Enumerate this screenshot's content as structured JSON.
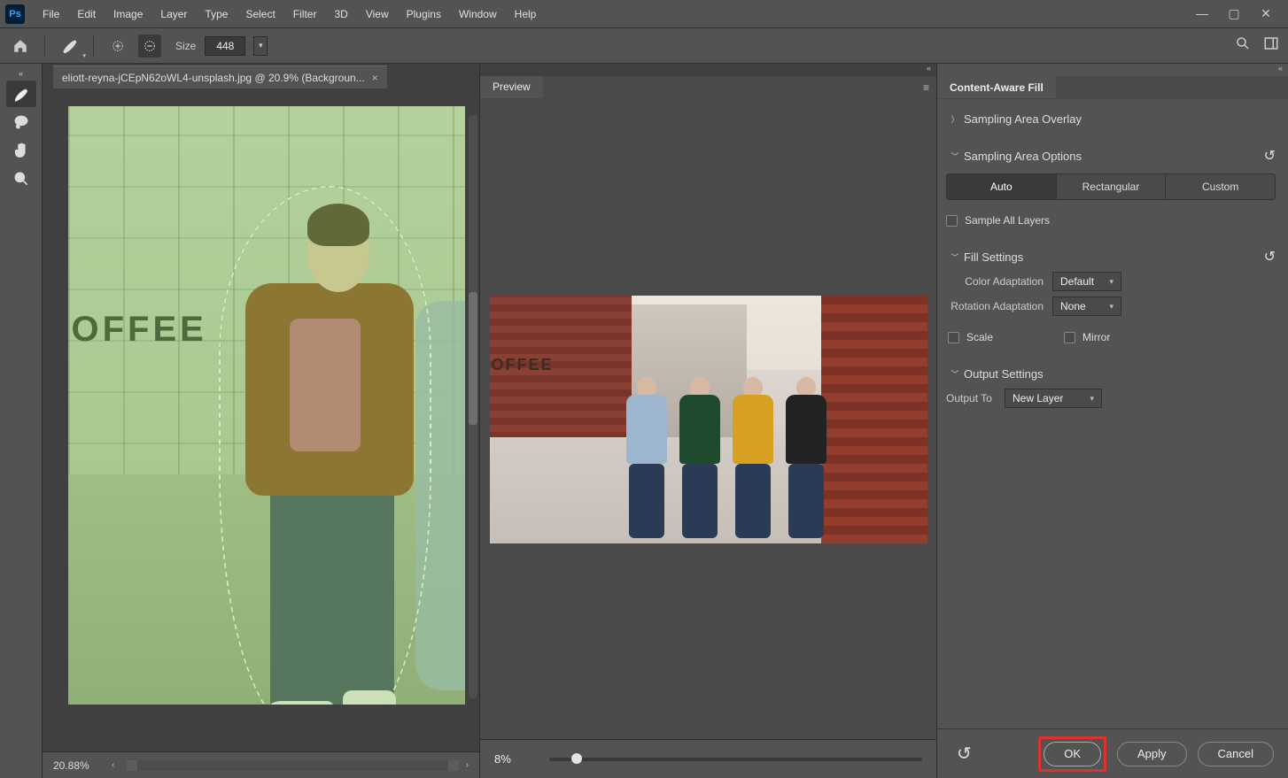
{
  "menubar": {
    "items": [
      "File",
      "Edit",
      "Image",
      "Layer",
      "Type",
      "Select",
      "Filter",
      "3D",
      "View",
      "Plugins",
      "Window",
      "Help"
    ]
  },
  "optionsbar": {
    "size_label": "Size",
    "size_value": "448"
  },
  "tools": {
    "items": [
      "sampling-brush-tool",
      "lasso-tool",
      "hand-tool",
      "zoom-tool"
    ]
  },
  "document": {
    "tab_title": "eliott-reyna-jCEpN62oWL4-unsplash.jpg @ 20.9% (Backgroun...",
    "coffee_text": "OFFEE",
    "zoom": "20.88%"
  },
  "preview": {
    "tab_label": "Preview",
    "coffee_text": "OFFEE",
    "zoom": "8%"
  },
  "caf": {
    "title": "Content-Aware Fill",
    "sections": {
      "overlay": {
        "label": "Sampling Area Overlay"
      },
      "options": {
        "label": "Sampling Area Options",
        "segs": [
          "Auto",
          "Rectangular",
          "Custom"
        ],
        "sample_all": "Sample All Layers"
      },
      "fill": {
        "label": "Fill Settings",
        "color_adapt_label": "Color Adaptation",
        "color_adapt_value": "Default",
        "rotation_label": "Rotation Adaptation",
        "rotation_value": "None",
        "scale_label": "Scale",
        "mirror_label": "Mirror"
      },
      "output": {
        "label": "Output Settings",
        "output_to_label": "Output To",
        "output_to_value": "New Layer"
      }
    },
    "buttons": {
      "ok": "OK",
      "apply": "Apply",
      "cancel": "Cancel"
    }
  }
}
